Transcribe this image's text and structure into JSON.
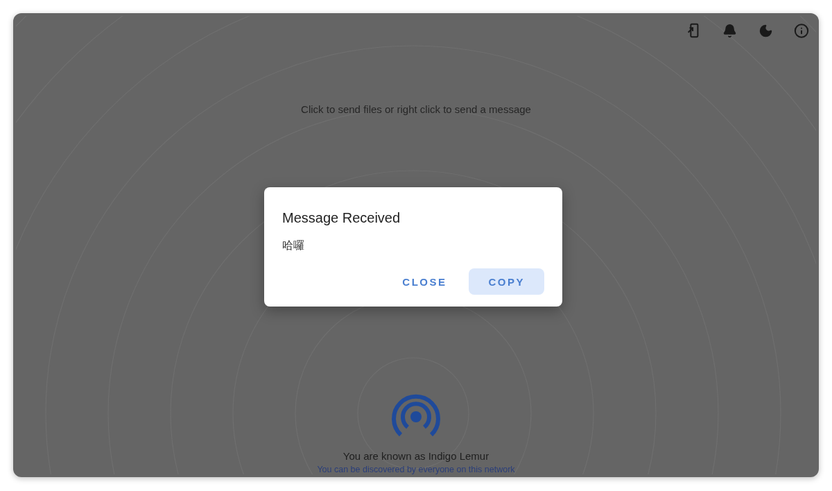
{
  "hint": "Click to send files or right click to send a message",
  "dialog": {
    "title": "Message Received",
    "message": "哈囉",
    "buttons": [
      {
        "label": "CLOSE",
        "kind": "text"
      },
      {
        "label": "COPY",
        "kind": "filled"
      }
    ]
  },
  "footer": {
    "name": "You are known as Indigo Lemur",
    "discovery": "You can be discovered by everyone on this network"
  }
}
